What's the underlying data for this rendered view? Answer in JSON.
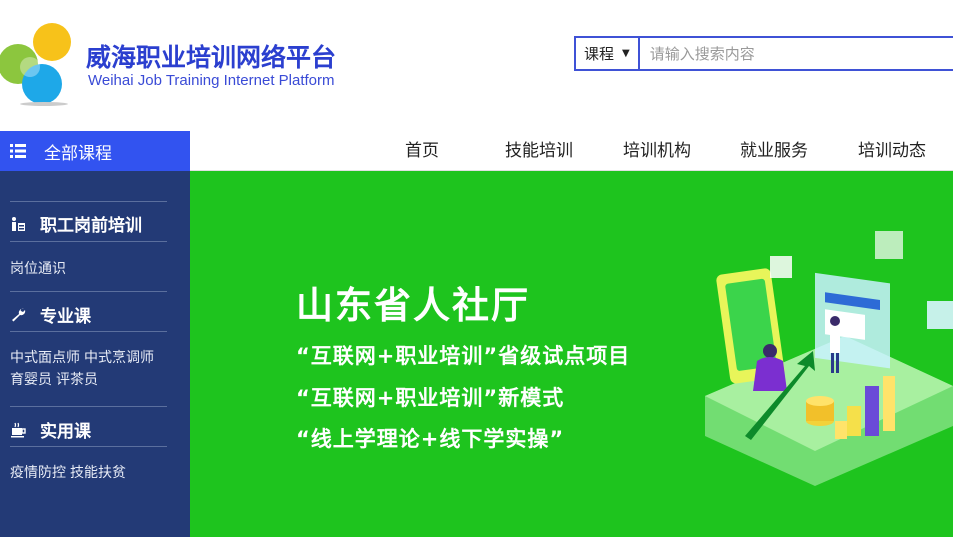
{
  "header": {
    "title": "威海职业培训网络平台",
    "subtitle": "Weihai Job Training Internet Platform"
  },
  "search": {
    "scope": "课程",
    "placeholder": "请输入搜索内容"
  },
  "nav": {
    "all_courses": "全部课程",
    "items": [
      "首页",
      "技能培训",
      "培训机构",
      "就业服务",
      "培训动态"
    ]
  },
  "sidebar": {
    "sections": [
      {
        "heading": "职工岗前培训",
        "icon": "people-icon",
        "links": [
          [
            "岗位通识"
          ]
        ]
      },
      {
        "heading": "专业课",
        "icon": "wrench-icon",
        "links": [
          [
            "中式面点师",
            "中式烹调师"
          ],
          [
            "育婴员",
            "评茶员"
          ]
        ]
      },
      {
        "heading": "实用课",
        "icon": "cup-icon",
        "links": [
          [
            "疫情防控",
            "技能扶贫"
          ]
        ]
      }
    ]
  },
  "banner": {
    "title": "山东省人社厅",
    "lines": [
      "“互联网+职业培训”省级试点项目",
      "“互联网+职业培训”新模式",
      "“线上学理论+线下学实操”"
    ],
    "bg_color": "#1ec41e"
  },
  "colors": {
    "brand_blue": "#2b3fcf",
    "nav_accent": "#3253f0",
    "sidebar_bg": "#233a76"
  }
}
